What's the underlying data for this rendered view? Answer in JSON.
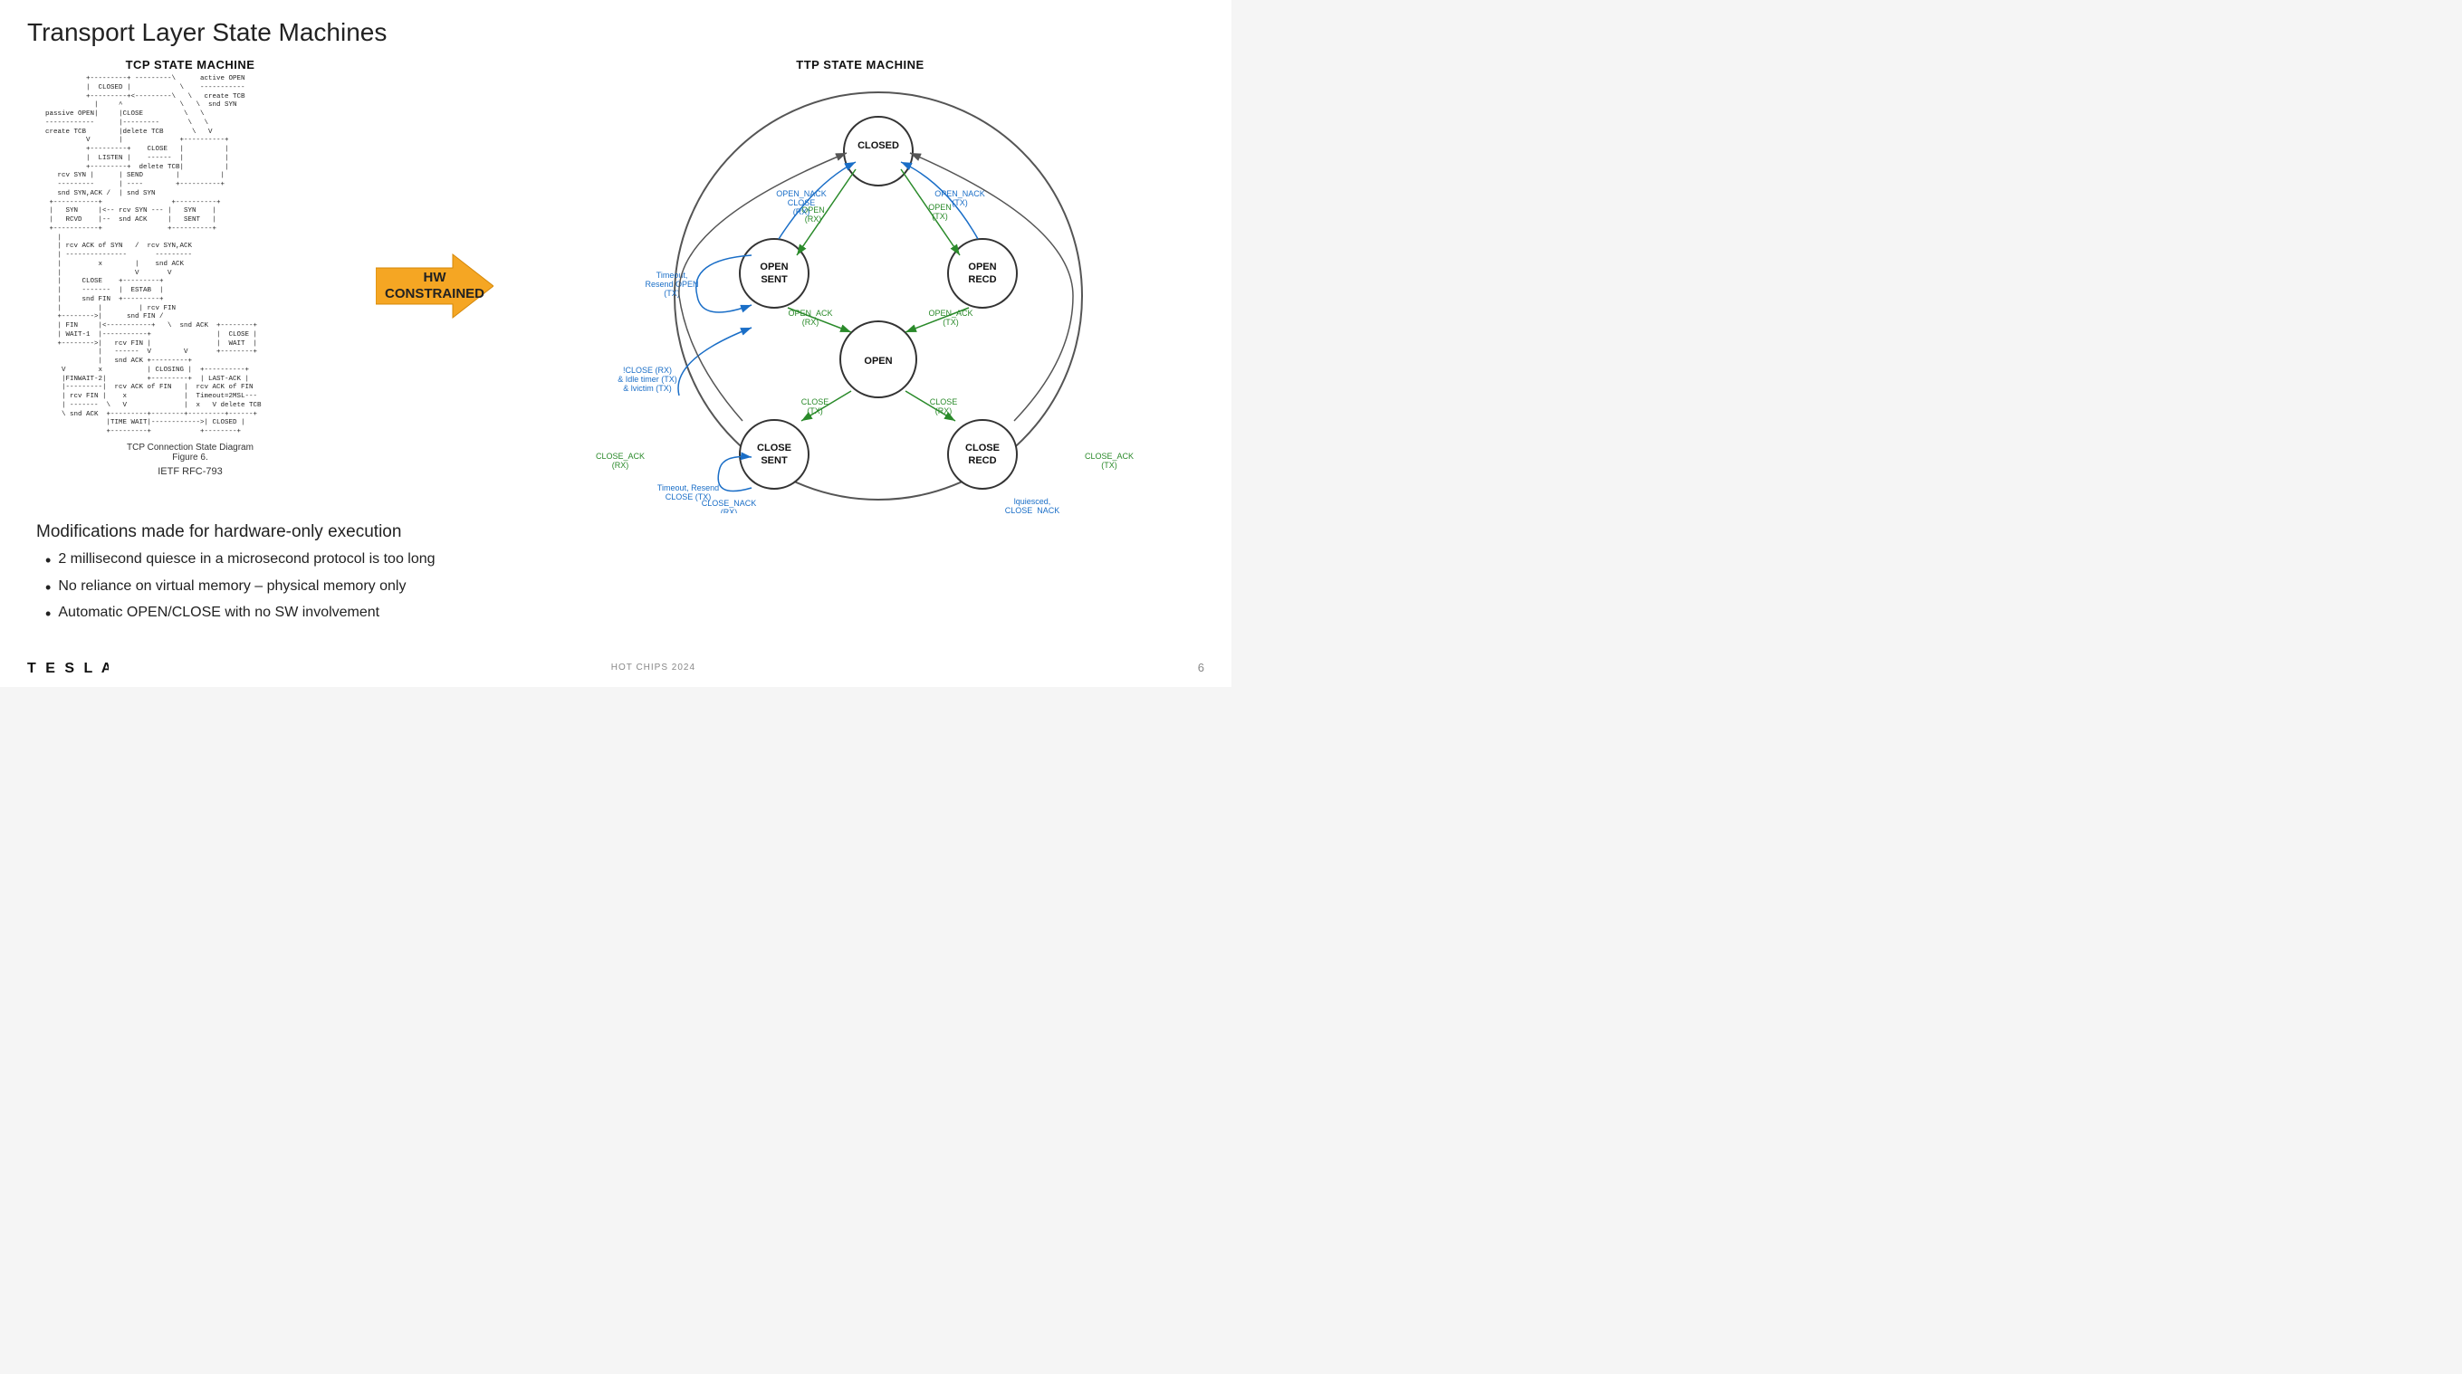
{
  "slide": {
    "title": "Transport Layer State Machines",
    "tcp_section": {
      "title": "TCP STATE MACHINE",
      "diagram_lines": [
        "          +---------+ ---------\\      active OPEN",
        "          |  CLOSED |            \\    -----------",
        "          +---------+<---------\\   \\   create TCB",
        "            |     ^              \\   \\  snd SYN",
        "passive OPEN|     |CLOSE         \\   \\",
        "------------      |---------      \\   \\",
        "create TCB        |delete TCB      \\   \\",
        "          V       |                 \\   V",
        "          +---------+    CLOSE       +--------+",
        "          |  LISTEN |    -------     |        |",
        "          +---------+    delete TCB  |        |",
        "   rcv SYN |      | SEND             |        |",
        "   ---------      | ----             |        |",
        "   snd SYN,ACK /  | snd SYN    +--------+    |",
        " +-----------+ +-----------+   |  SYN   |    |",
        " | SYN       | rcv SYN    |   |  RCVD  |    |SYN",
        " | RCVD      |<-----------+   +--------+    |SENT",
        " +-----------+  snd ACK                     |    |",
        "   |        |                                |    |",
        "   | rcv ACK of SYN  /   rcv SYN,ACK        |    |",
        "   | ---------------       ---------         |    |",
        "   |         x        |    snd ACK           |    |",
        "   |                  V       V               |    |",
        "   |     CLOSE    +---------+                 |    |",
        "   |     -------  |  ESTAB  |                 |    |",
        "   |     snd FIN  +---------+                 |    |",
        "   |         |         | rcv FIN              |    |",
        "   +-------->|      snd FIN /                 |    |",
        "   | FIN     |<-----------+   \\  snd ACK +--------+",
        "   | WAIT-1  |-----------+                | CLOSE  |",
        "   +-------->|   rcv FIN |                |  WAIT  |",
        "             |   ------  V       V        +--------+",
        "             |   snd ACK +---------+",
        "   V         x           | CLOSING |  +----------+",
        "   |FINWAIT-2|           +---------+  | LAST-ACK |",
        "   |---------|rcv ACK of FIN|  rcv ACK of FIN",
        "   | rcv FIN |              |  Timeout=2MSL ---",
        "   | ------- |         x    |  x      V delete TCB",
        "   \\ snd ACK +---------+----+----------+-------+",
        "             |TIME WAIT|------------>| CLOSED |",
        "             +---------+            +--------+"
      ],
      "caption_line1": "TCP Connection State Diagram",
      "caption_line2": "Figure 6.",
      "rfc": "IETF RFC-793"
    },
    "hw_arrow": {
      "line1": "HW",
      "line2": "CONSTRAINED"
    },
    "ttp_section": {
      "title": "TTP STATE MACHINE",
      "states": [
        "CLOSED",
        "OPEN SENT",
        "OPEN RECD",
        "OPEN",
        "CLOSE SENT",
        "CLOSE RECD"
      ],
      "transitions": [
        {
          "label": "OPEN_NACK\nCLOSE\n(RX)",
          "color": "blue"
        },
        {
          "label": "OPEN_NACK\n(TX)",
          "color": "blue"
        },
        {
          "label": "OPEN\n(RX)",
          "color": "green"
        },
        {
          "label": "OPEN\n(TX)",
          "color": "green"
        },
        {
          "label": "Timeout,\nResend OPEN\n(TX)",
          "color": "blue"
        },
        {
          "label": "OPEN_ACK\n(RX)",
          "color": "green"
        },
        {
          "label": "OPEN_ACK\n(TX)",
          "color": "green"
        },
        {
          "label": "!CLOSE (RX)\n& Idle timer (TX)\n& lvictim (TX)",
          "color": "blue"
        },
        {
          "label": "CLOSE_ACK\n(RX)",
          "color": "green"
        },
        {
          "label": "CLOSE_ACK\n(TX)",
          "color": "green"
        },
        {
          "label": "CLOSE\n(TX)",
          "color": "green"
        },
        {
          "label": "CLOSE\n(RX)",
          "color": "green"
        },
        {
          "label": "CLOSE_NACK\n(RX)",
          "color": "blue"
        },
        {
          "label": "Timeout, Resend\nCLOSE (TX)",
          "color": "blue"
        },
        {
          "label": "lquiesced,\nCLOSE_NACK\n(TX)",
          "color": "blue"
        }
      ]
    },
    "modifications": {
      "title": "Modifications made for hardware-only execution",
      "bullets": [
        "2 millisecond quiesce in a microsecond protocol is too long",
        "No reliance on virtual memory – physical memory only",
        "Automatic OPEN/CLOSE with no SW involvement"
      ]
    },
    "footer": {
      "logo": "T E S L A",
      "center": "HOT CHIPS 2024",
      "page": "6"
    }
  }
}
